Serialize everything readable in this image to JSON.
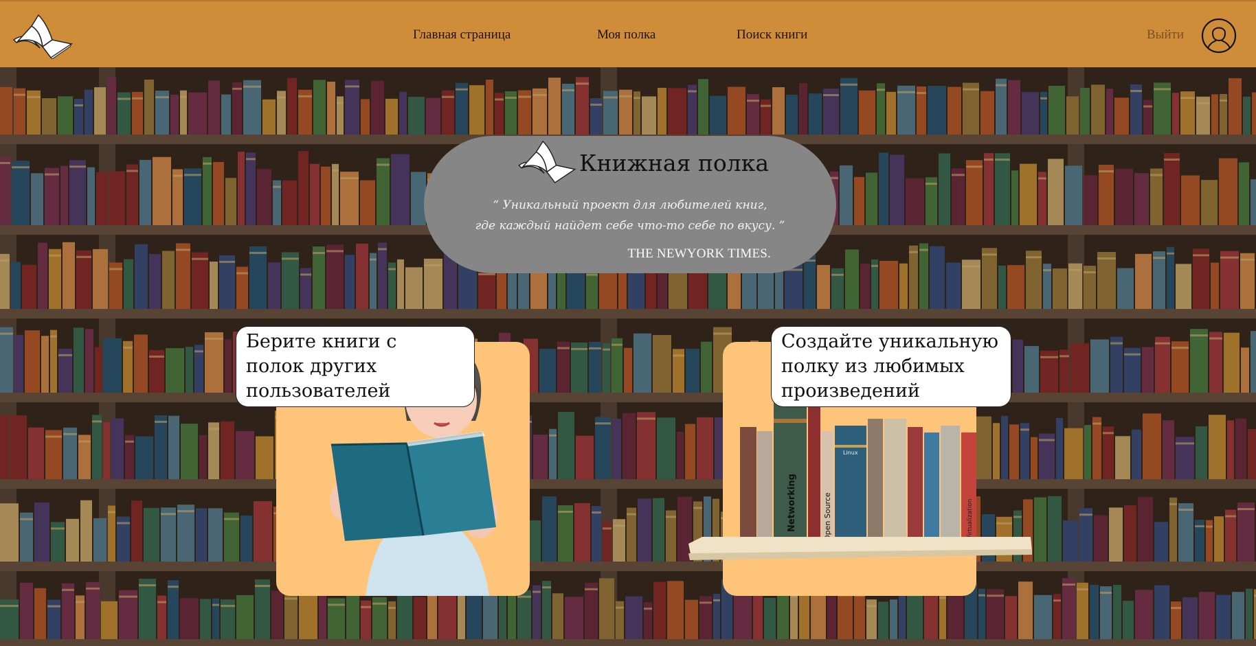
{
  "header": {
    "nav": {
      "home": "Главная страница",
      "shelf": "Моя полка",
      "search": "Поиск книги"
    },
    "logout": "Выйти",
    "icons": {
      "logo": "open-book-icon",
      "profile": "user-profile-icon"
    }
  },
  "hero": {
    "title": "Книжная полка",
    "quote_line1": "“ Уникальный проект для любителей книг,",
    "quote_line2": "где каждый найдет себе что-то себе по вкусу. ”",
    "source": "THE NEWYORK TIMES."
  },
  "features": [
    {
      "line1": "Берите книги с",
      "line2": "полок других",
      "line3": "пользователей"
    },
    {
      "line1": "Создайте уникальную",
      "line2": "полку из любимых",
      "line3": "произведений"
    }
  ],
  "shelf_books": {
    "networking": "Networking",
    "open_source": "Open Source",
    "linux": "Linux",
    "virtualization": "Virtualization"
  },
  "colors": {
    "header_bg": "#cf8d3a",
    "hero_bg": "#868686",
    "card_bg": "#fec47a",
    "bubble_bg": "#ffffff"
  }
}
